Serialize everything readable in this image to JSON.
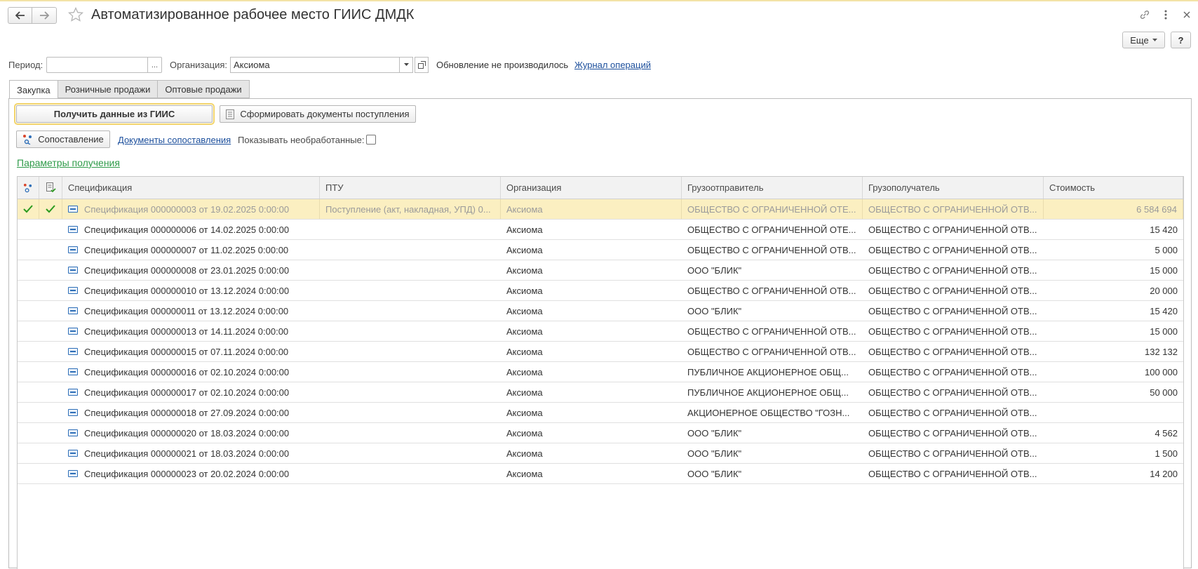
{
  "window": {
    "title": "Автоматизированное рабочее место ГИИС ДМДК",
    "more_label": "Еще",
    "help_label": "?"
  },
  "filters": {
    "period_label": "Период:",
    "period_value": "",
    "period_button": "...",
    "org_label": "Организация:",
    "org_value": "Аксиома",
    "update_status": "Обновление не производилось",
    "journal_link": "Журнал операций"
  },
  "tabs": [
    {
      "label": "Закупка",
      "active": true
    },
    {
      "label": "Розничные продажи",
      "active": false
    },
    {
      "label": "Оптовые продажи",
      "active": false
    }
  ],
  "toolbar": {
    "get_data_label": "Получить данные из ГИИС",
    "create_docs_label": "Сформировать документы поступления",
    "match_label": "Сопоставление",
    "match_docs_link": "Документы сопоставления",
    "show_unprocessed_label": "Показывать необработанные:",
    "show_unprocessed_checked": false,
    "params_link": "Параметры получения"
  },
  "table": {
    "columns": [
      "Спецификация",
      "ПТУ",
      "Организация",
      "Грузоотправитель",
      "Грузополучатель",
      "Стоимость"
    ],
    "rows": [
      {
        "matched": true,
        "doc": true,
        "spec": "Спецификация 000000003 от 19.02.2025 0:00:00",
        "ptu": "Поступление (акт, накладная, УПД) 0...",
        "org": "Аксиома",
        "sender": "ОБЩЕСТВО С ОГРАНИЧЕННОЙ ОТЕ...",
        "receiver": "ОБЩЕСТВО С ОГРАНИЧЕННОЙ ОТВ...",
        "cost": "6 584 694"
      },
      {
        "matched": false,
        "doc": false,
        "spec": "Спецификация 000000006 от 14.02.2025 0:00:00",
        "ptu": "",
        "org": "Аксиома",
        "sender": "ОБЩЕСТВО С ОГРАНИЧЕННОЙ ОТЕ...",
        "receiver": "ОБЩЕСТВО С ОГРАНИЧЕННОЙ ОТВ...",
        "cost": "15 420"
      },
      {
        "matched": false,
        "doc": false,
        "spec": "Спецификация 000000007 от 11.02.2025 0:00:00",
        "ptu": "",
        "org": "Аксиома",
        "sender": "ОБЩЕСТВО С ОГРАНИЧЕННОЙ ОТВ...",
        "receiver": "ОБЩЕСТВО С ОГРАНИЧЕННОЙ ОТВ...",
        "cost": "5 000"
      },
      {
        "matched": false,
        "doc": false,
        "spec": "Спецификация 000000008 от 23.01.2025 0:00:00",
        "ptu": "",
        "org": "Аксиома",
        "sender": "ООО \"БЛИК\"",
        "receiver": "ОБЩЕСТВО С ОГРАНИЧЕННОЙ ОТВ...",
        "cost": "15 000"
      },
      {
        "matched": false,
        "doc": false,
        "spec": "Спецификация 000000010 от 13.12.2024 0:00:00",
        "ptu": "",
        "org": "Аксиома",
        "sender": "ОБЩЕСТВО С ОГРАНИЧЕННОЙ ОТВ...",
        "receiver": "ОБЩЕСТВО С ОГРАНИЧЕННОЙ ОТВ...",
        "cost": "20 000"
      },
      {
        "matched": false,
        "doc": false,
        "spec": "Спецификация 000000011 от 13.12.2024 0:00:00",
        "ptu": "",
        "org": "Аксиома",
        "sender": "ООО \"БЛИК\"",
        "receiver": "ОБЩЕСТВО С ОГРАНИЧЕННОЙ ОТВ...",
        "cost": "15 420"
      },
      {
        "matched": false,
        "doc": false,
        "spec": "Спецификация 000000013 от 14.11.2024 0:00:00",
        "ptu": "",
        "org": "Аксиома",
        "sender": "ОБЩЕСТВО С ОГРАНИЧЕННОЙ ОТВ...",
        "receiver": "ОБЩЕСТВО С ОГРАНИЧЕННОЙ ОТВ...",
        "cost": "15 000"
      },
      {
        "matched": false,
        "doc": false,
        "spec": "Спецификация 000000015 от 07.11.2024 0:00:00",
        "ptu": "",
        "org": "Аксиома",
        "sender": "ОБЩЕСТВО С ОГРАНИЧЕННОЙ ОТВ...",
        "receiver": "ОБЩЕСТВО С ОГРАНИЧЕННОЙ ОТВ...",
        "cost": "132 132"
      },
      {
        "matched": false,
        "doc": false,
        "spec": "Спецификация 000000016 от 02.10.2024 0:00:00",
        "ptu": "",
        "org": "Аксиома",
        "sender": "ПУБЛИЧНОЕ АКЦИОНЕРНОЕ ОБЩ...",
        "receiver": "ОБЩЕСТВО С ОГРАНИЧЕННОЙ ОТВ...",
        "cost": "100 000"
      },
      {
        "matched": false,
        "doc": false,
        "spec": "Спецификация 000000017 от 02.10.2024 0:00:00",
        "ptu": "",
        "org": "Аксиома",
        "sender": "ПУБЛИЧНОЕ АКЦИОНЕРНОЕ ОБЩ...",
        "receiver": "ОБЩЕСТВО С ОГРАНИЧЕННОЙ ОТВ...",
        "cost": "50 000"
      },
      {
        "matched": false,
        "doc": false,
        "spec": "Спецификация 000000018 от 27.09.2024 0:00:00",
        "ptu": "",
        "org": "Аксиома",
        "sender": "АКЦИОНЕРНОЕ ОБЩЕСТВО \"ГОЗН...",
        "receiver": "ОБЩЕСТВО С ОГРАНИЧЕННОЙ ОТВ...",
        "cost": ""
      },
      {
        "matched": false,
        "doc": false,
        "spec": "Спецификация 000000020 от 18.03.2024 0:00:00",
        "ptu": "",
        "org": "Аксиома",
        "sender": "ООО \"БЛИК\"",
        "receiver": "ОБЩЕСТВО С ОГРАНИЧЕННОЙ ОТВ...",
        "cost": "4 562"
      },
      {
        "matched": false,
        "doc": false,
        "spec": "Спецификация 000000021 от 18.03.2024 0:00:00",
        "ptu": "",
        "org": "Аксиома",
        "sender": "ООО \"БЛИК\"",
        "receiver": "ОБЩЕСТВО С ОГРАНИЧЕННОЙ ОТВ...",
        "cost": "1 500"
      },
      {
        "matched": false,
        "doc": false,
        "spec": "Спецификация 000000023 от 20.02.2024 0:00:00",
        "ptu": "",
        "org": "Аксиома",
        "sender": "ООО \"БЛИК\"",
        "receiver": "ОБЩЕСТВО С ОГРАНИЧЕННОЙ ОТВ...",
        "cost": "14 200"
      }
    ]
  },
  "colors": {
    "accent_link": "#1c4f9c",
    "params_link": "#2e9b49",
    "check": "#2a9a1e",
    "selected_row": "#fbefc1",
    "primary_outline": "#f2d46b"
  }
}
